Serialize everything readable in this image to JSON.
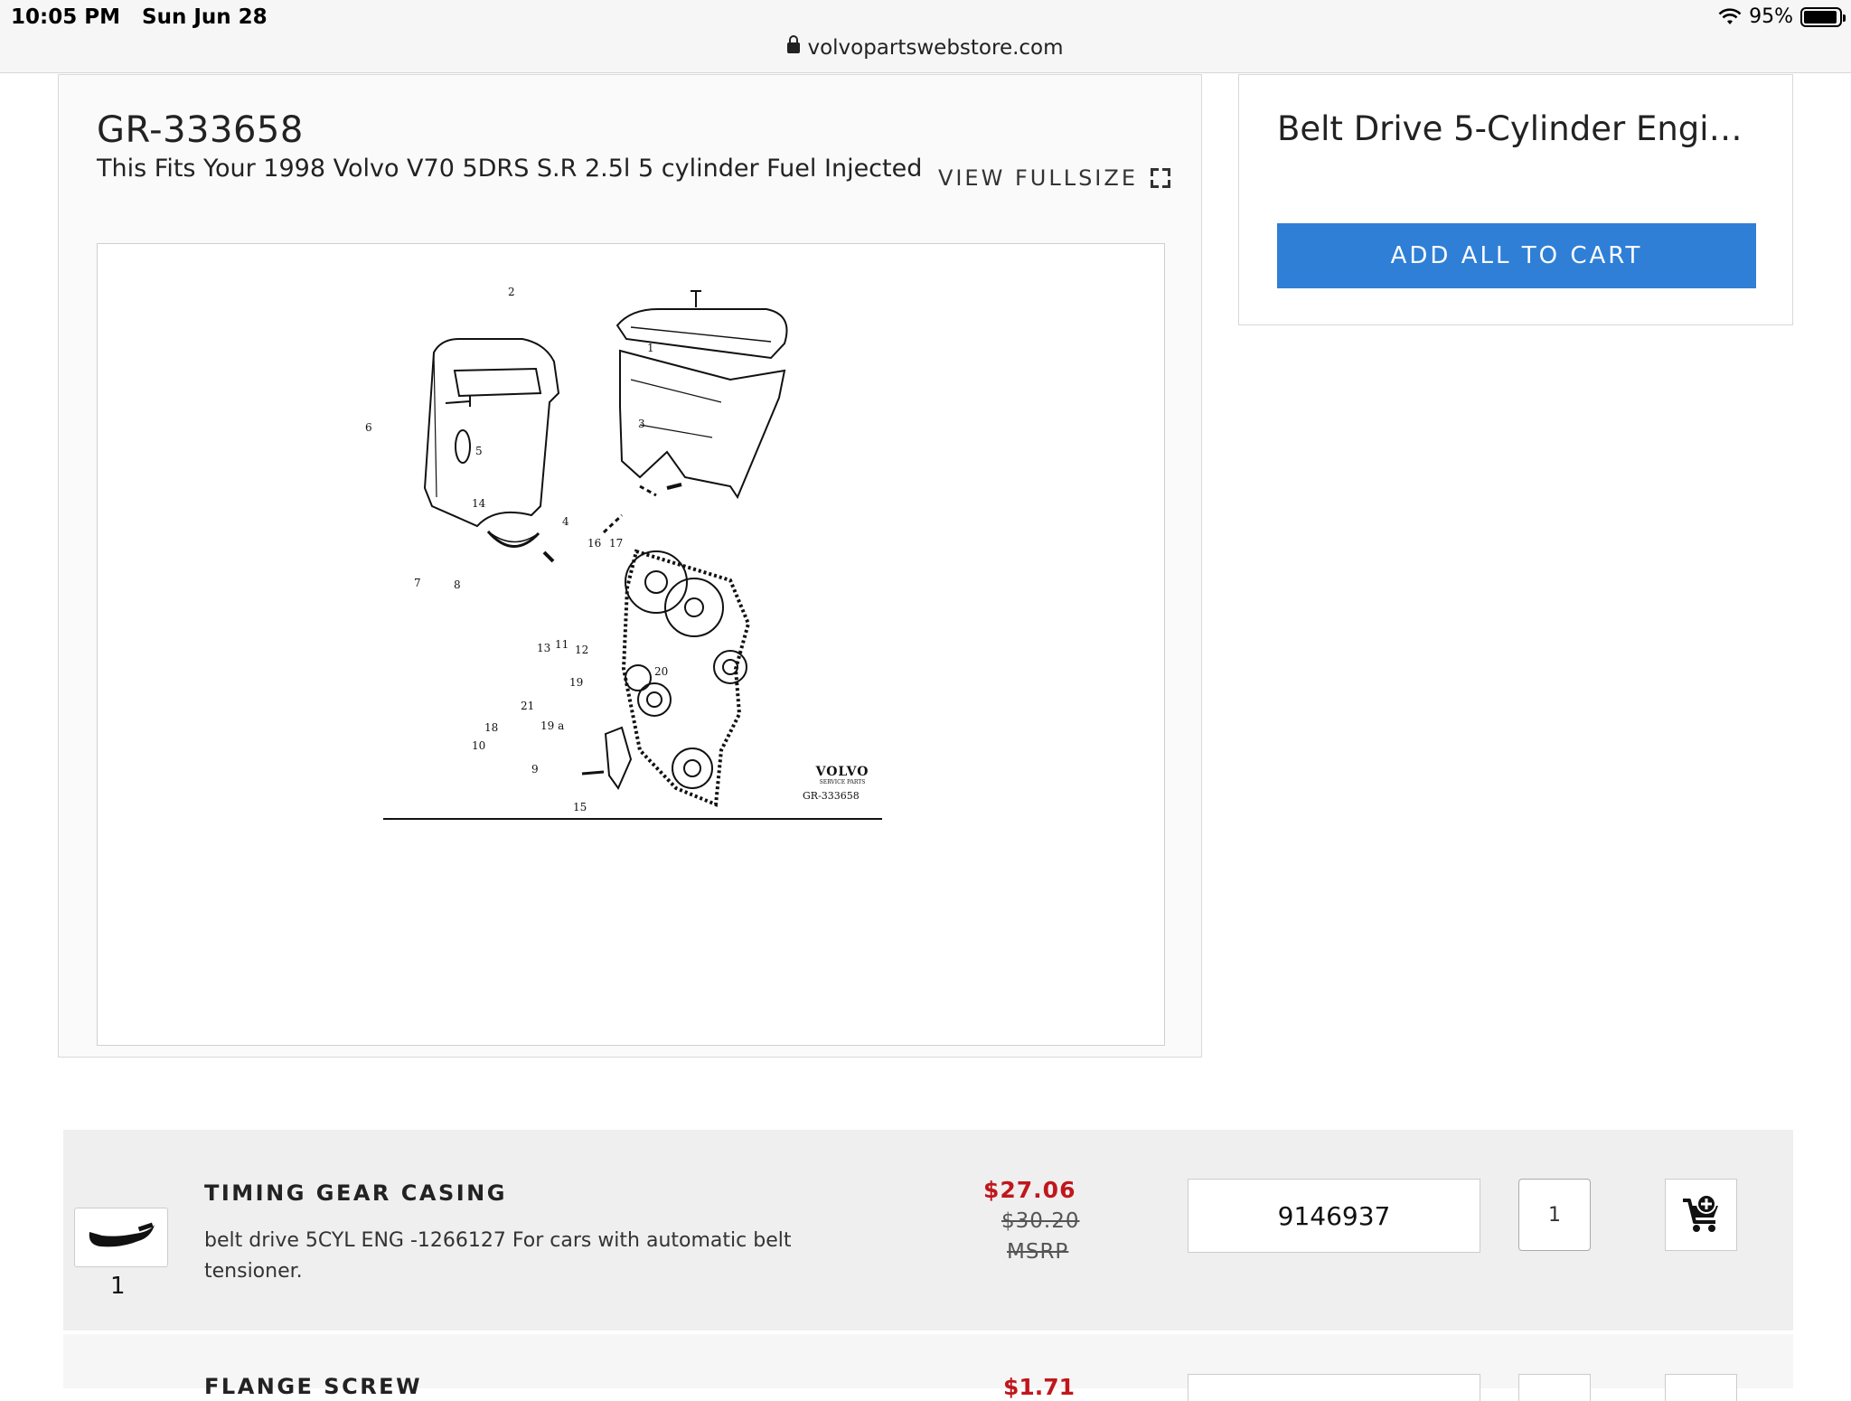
{
  "status_bar": {
    "time": "10:05 PM",
    "date": "Sun Jun 28",
    "battery": "95%",
    "battery_level": 0.95
  },
  "browser": {
    "url": "volvopartswebstore.com"
  },
  "diagram": {
    "part_id": "GR-333658",
    "fitment": "This Fits Your 1998 Volvo V70 5DRS S.R 2.5l 5 cylinder Fuel Injected",
    "view_fullsize_label": "VIEW FULLSIZE",
    "callouts": [
      "1",
      "2",
      "3",
      "4",
      "5",
      "6",
      "7",
      "8",
      "9",
      "10",
      "11",
      "12",
      "13",
      "14",
      "15",
      "16",
      "17",
      "18",
      "19",
      "19 a",
      "20",
      "21"
    ],
    "logo_text": "VOLVO",
    "logo_sub": "SERVICE PARTS",
    "ref": "GR-333658"
  },
  "side_panel": {
    "title": "Belt Drive 5-Cylinder Engin...",
    "add_all_label": "ADD ALL TO CART"
  },
  "parts": [
    {
      "callout": "1",
      "name": "TIMING GEAR CASING",
      "description": "belt drive 5CYL ENG -1266127 For cars with automatic belt tensioner.",
      "price": "$27.06",
      "msrp_price": "$30.20",
      "msrp_label": "MSRP",
      "part_number": "9146937",
      "quantity": "1"
    },
    {
      "name": "FLANGE SCREW",
      "price": "$1.71"
    }
  ],
  "colors": {
    "accent": "#2f7fd6",
    "price_red": "#c0171c"
  }
}
